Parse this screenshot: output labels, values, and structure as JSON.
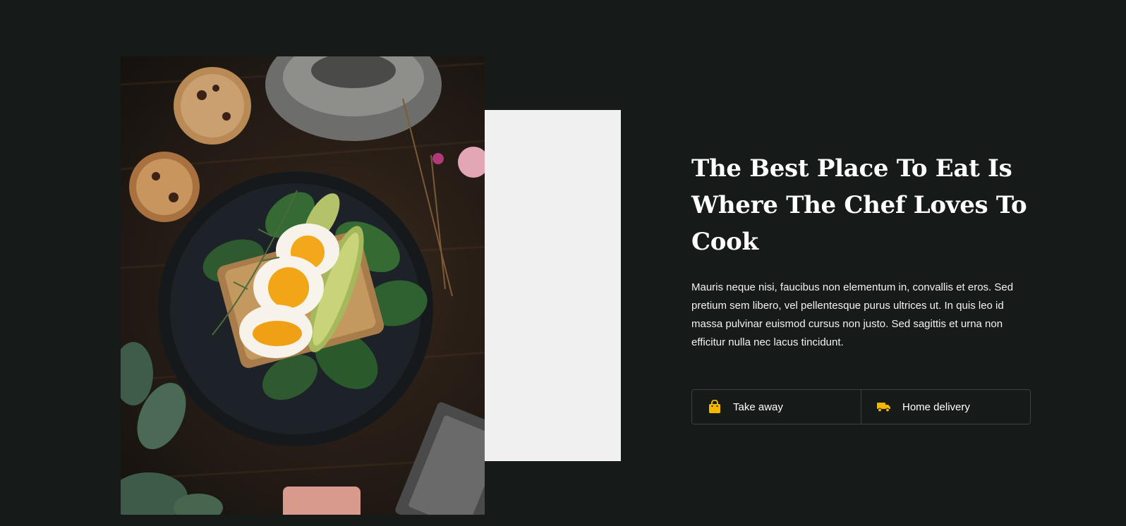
{
  "headline": "The Best Place To Eat Is Where The Chef Loves To Cook",
  "description": "Mauris neque nisi, faucibus non elementum in, convallis et eros. Sed pretium sem libero, vel pellentesque purus ultrices ut. In quis leo id massa pulvinar euismod cursus non justo. Sed sagittis et urna non efficitur nulla nec lacus tincidunt.",
  "options": [
    {
      "label": "Take away",
      "icon": "shopping-bag-icon"
    },
    {
      "label": "Home delivery",
      "icon": "delivery-truck-icon"
    }
  ],
  "colors": {
    "background": "#161a18",
    "accent": "#f5b800",
    "panel": "#f0f0f0",
    "border": "#3d4240"
  }
}
